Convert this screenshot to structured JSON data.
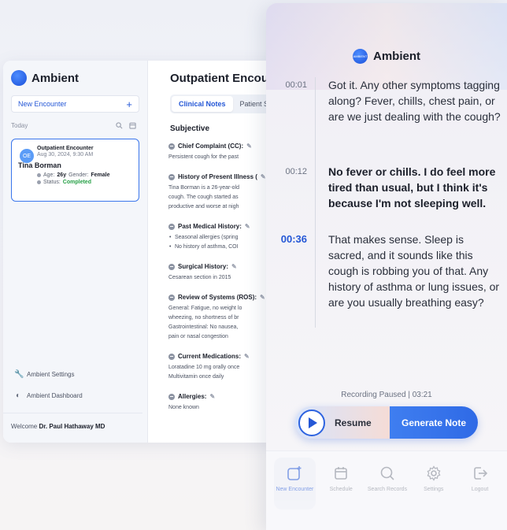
{
  "desktop": {
    "brand": "Ambient",
    "new_encounter": "New Encounter",
    "today_label": "Today",
    "encounter_card": {
      "avatar": "OE",
      "title": "Outpatient Encounter",
      "date": "Aug 30, 2024, 9:30 AM",
      "patient": "Tina Borman",
      "age_label": "Age:",
      "age": "26y",
      "gender_label": "Gender:",
      "gender": "Female",
      "status_label": "Status:",
      "status": "Completed"
    },
    "settings": "Ambient Settings",
    "dashboard": "Ambient Dashboard",
    "welcome_prefix": "Welcome",
    "welcome_name": "Dr. Paul Hathaway MD",
    "main_title": "Outpatient Encounte",
    "tabs": [
      "Clinical Notes",
      "Patient S"
    ],
    "section": "Subjective",
    "notes": [
      {
        "title": "Chief Complaint (CC):",
        "lines": [
          "Persistent cough for the past"
        ],
        "bullets": []
      },
      {
        "title": "History of Present Illness (",
        "lines": [
          "Tina Borman is a 26-year-old",
          "cough. The cough started as",
          "productive and worse at nigh"
        ],
        "bullets": []
      },
      {
        "title": "Past Medical History:",
        "lines": [],
        "bullets": [
          "Seasonal allergies (spring",
          "No history of asthma, COI"
        ]
      },
      {
        "title": "Surgical History:",
        "lines": [
          "Cesarean section in 2015"
        ],
        "bullets": []
      },
      {
        "title": "Review of Systems (ROS):",
        "lines": [
          "General: Fatigue, no weight lo",
          "wheezing, no shortness of br",
          "Gastrointestinal: No nausea,",
          "pain or nasal congestion"
        ],
        "bullets": []
      },
      {
        "title": "Current Medications:",
        "lines": [
          "Loratadine 10 mg orally once",
          "Multivitamin once daily"
        ],
        "bullets": []
      },
      {
        "title": "Allergies:",
        "lines": [
          "None known"
        ],
        "bullets": []
      }
    ]
  },
  "mobile": {
    "brand": "Ambient",
    "logo_text": "AMBIENT",
    "transcript": [
      {
        "time": "00:01",
        "text": "Got it. Any other symptoms tagging along? Fever, chills, chest pain, or are we just dealing with the cough?",
        "speaker": "clinician",
        "current": false
      },
      {
        "time": "00:12",
        "text": "No fever or chills. I do feel more tired than usual, but I think it's because I'm not sleeping well.",
        "speaker": "patient",
        "current": false
      },
      {
        "time": "00:36",
        "text": "That makes sense. Sleep is sacred, and it sounds like this cough is robbing you of that. Any history of asthma or lung issues, or are you usually breathing easy?",
        "speaker": "clinician",
        "current": true
      }
    ],
    "recording_status": "Recording Paused | 03:21",
    "resume": "Resume",
    "generate": "Generate Note",
    "nav": [
      {
        "label": "New Encounter",
        "icon": "new-encounter-icon"
      },
      {
        "label": "Schedule",
        "icon": "calendar-icon"
      },
      {
        "label": "Search Records",
        "icon": "search-icon"
      },
      {
        "label": "Settings",
        "icon": "gear-icon"
      },
      {
        "label": "Logout",
        "icon": "logout-icon"
      }
    ]
  },
  "colors": {
    "accent": "#2457d6",
    "success": "#27a047",
    "button": "#3f7ef0"
  }
}
